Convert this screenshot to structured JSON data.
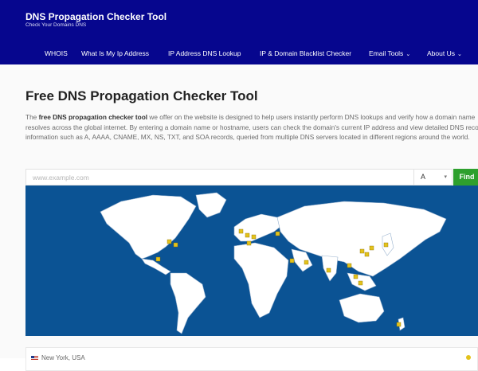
{
  "header": {
    "title": "DNS Propagation Checker Tool",
    "tagline": "Check Your Domains DNS",
    "background": "#06068e"
  },
  "nav": {
    "items": [
      {
        "label": "WHOIS"
      },
      {
        "label": "What Is My Ip Address"
      },
      {
        "label": "IP Address DNS Lookup"
      },
      {
        "label": "IP & Domain Blacklist Checker"
      },
      {
        "label": "Email Tools",
        "dropdown": true
      },
      {
        "label": "About Us",
        "dropdown": true
      }
    ]
  },
  "main": {
    "title": "Free DNS Propagation Checker Tool",
    "intro": {
      "prefix": "The ",
      "highlight": "free DNS propagation checker tool",
      "suffix": " we offer on the website is designed to help users instantly perform DNS lookups and verify how a domain name resolves across the global internet. By entering a domain name or hostname, users can check the domain's current IP address and view detailed DNS record information such as A, AAAA, CNAME, MX, NS, TXT, and SOA records, queried from multiple DNS servers located in different regions around the world."
    }
  },
  "search": {
    "placeholder": "www.example.com",
    "value": "",
    "record_type": "A",
    "find_label": "Find"
  },
  "map": {
    "ocean_color": "#0b5394",
    "land_color": "#ffffff",
    "marker_color": "#e3c21b"
  },
  "results": {
    "first_location": "New York, USA",
    "first_status": "pending"
  },
  "icons": [
    "chevron-down-icon",
    "us-flag-icon",
    "map-marker-icon"
  ]
}
